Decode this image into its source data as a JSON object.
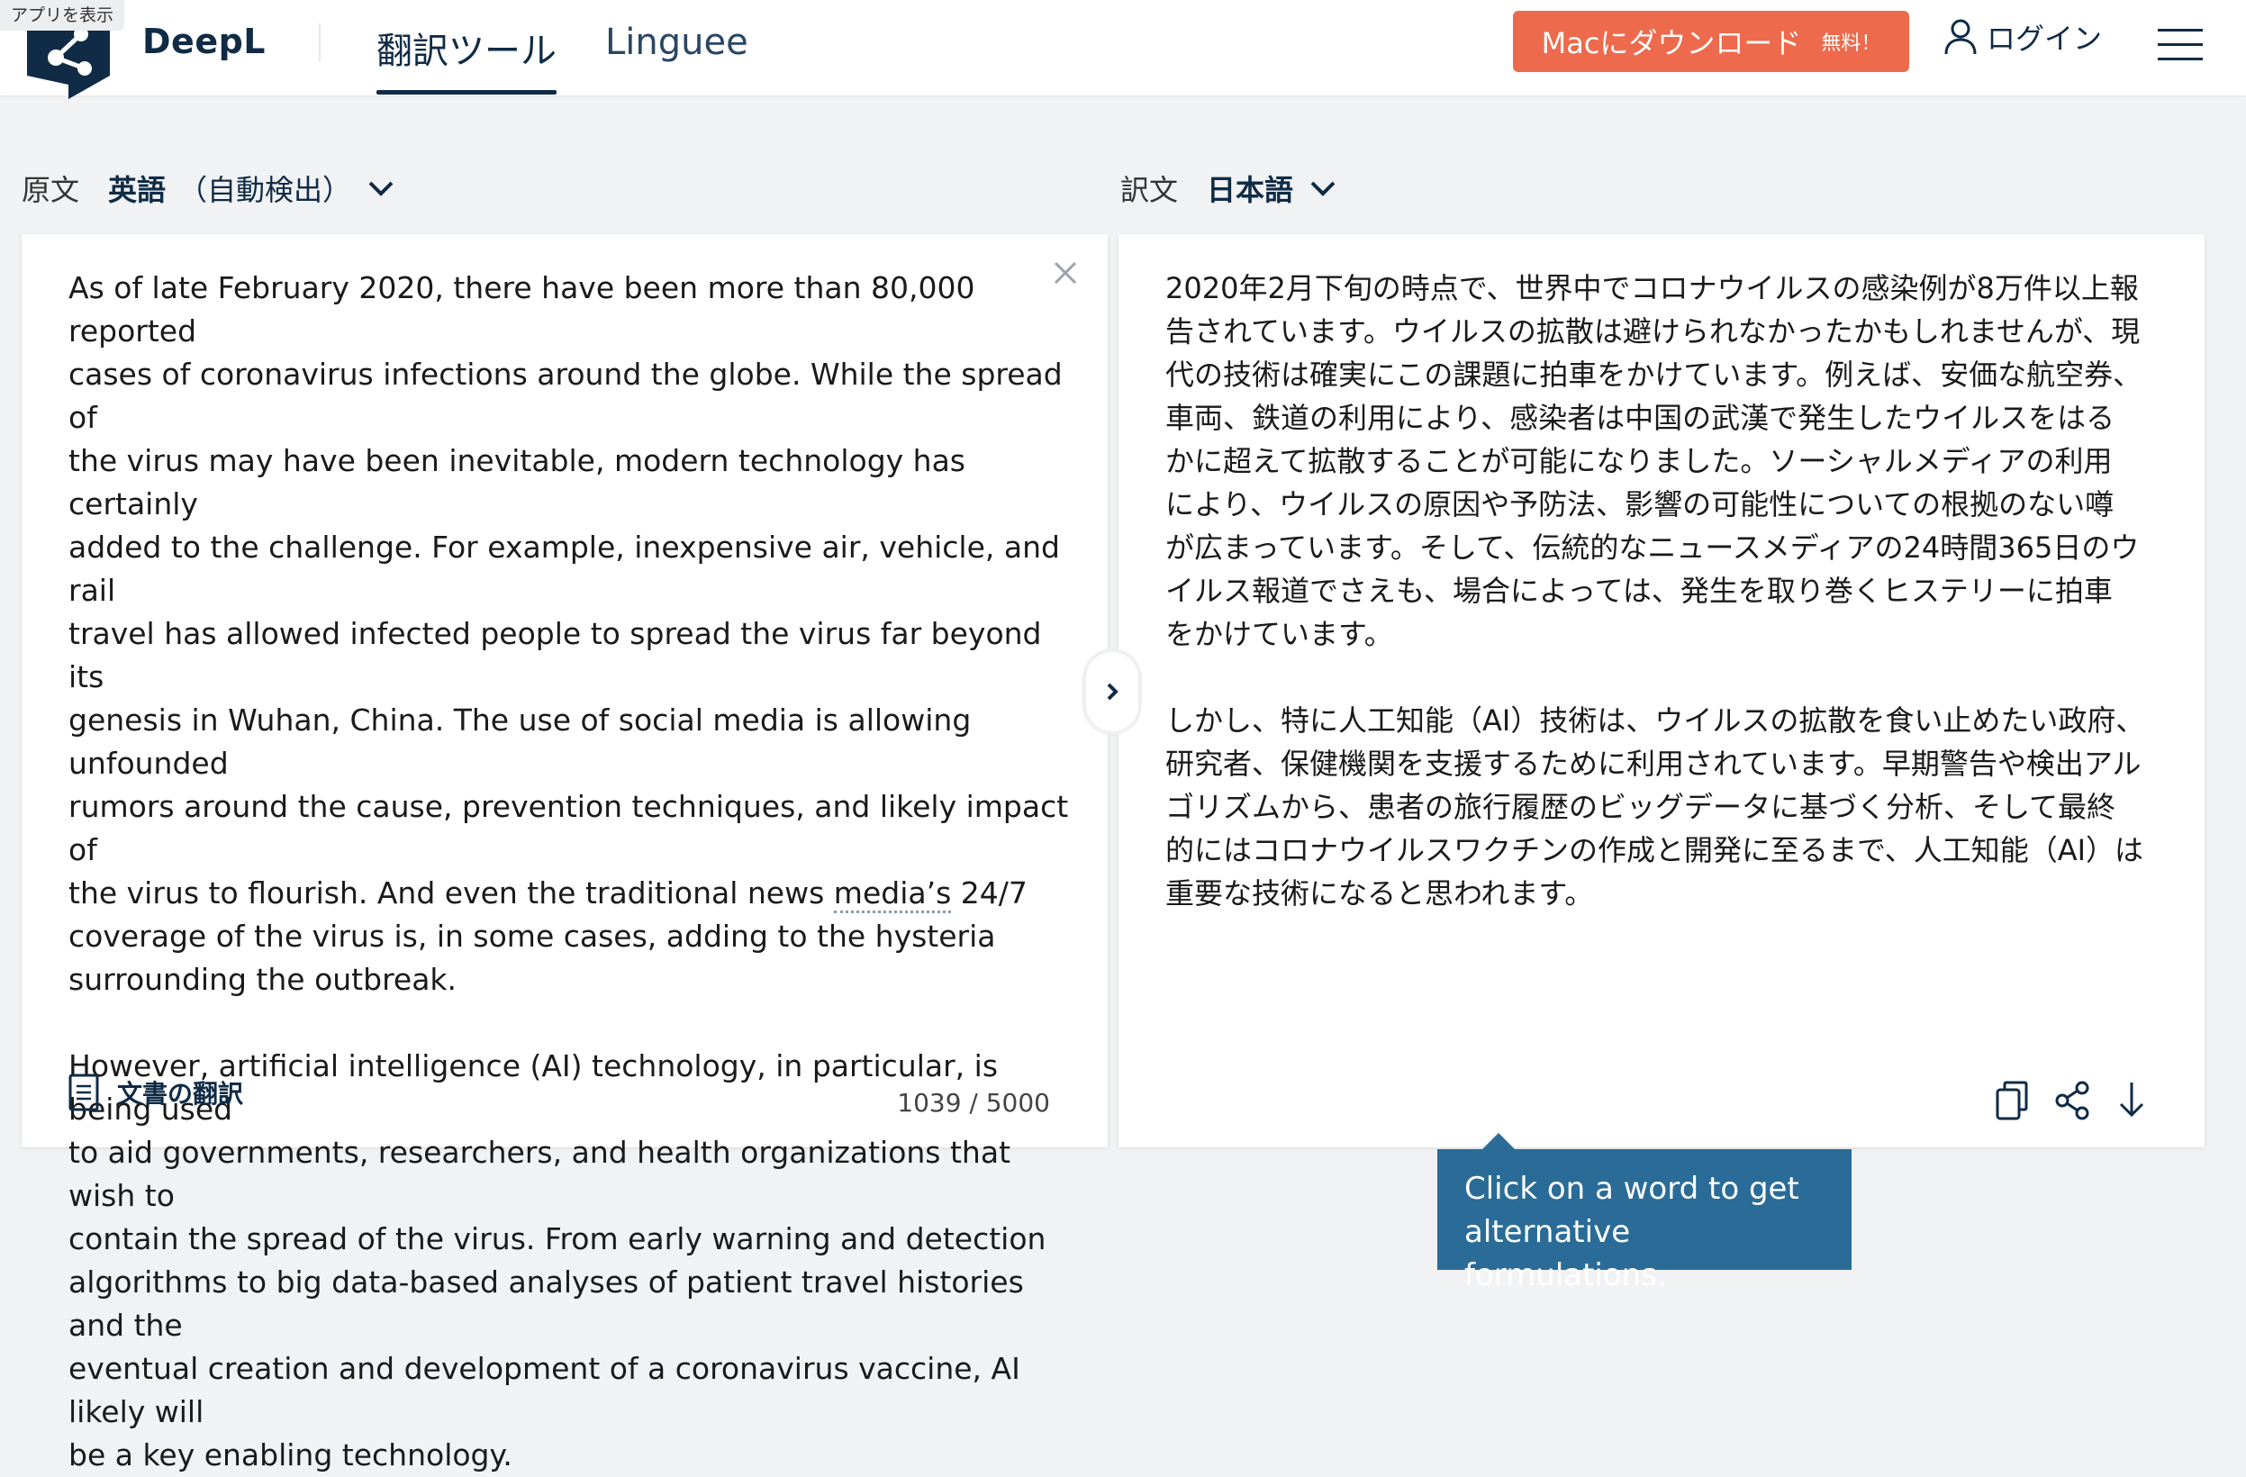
{
  "app_badge": "アプリを表示",
  "brand": "DeepL",
  "nav": {
    "translator_tab": "翻訳ツール",
    "linguee_tab": "Linguee"
  },
  "download": {
    "label": "Macにダウンロード",
    "free": "無料！"
  },
  "login_label": "ログイン",
  "source": {
    "label": "原文",
    "language": "英語",
    "auto": "（自動検出）",
    "text_before": "As of late February 2020, there have been more than 80,000 reported\ncases of coronavirus infections around the globe. While the spread of\nthe virus may have been inevitable, modern technology has certainly\nadded to the challenge. For example, inexpensive air, vehicle, and rail\ntravel has allowed infected people to spread the virus far beyond its\ngenesis in Wuhan, China. The use of social media is allowing unfounded\nrumors around the cause, prevention techniques, and likely impact of\nthe virus to flourish. And even the traditional news ",
    "text_underlined": "media’s",
    "text_after": " 24/7\ncoverage of the virus is, in some cases, adding to the hysteria\nsurrounding the outbreak.\n\nHowever, artificial intelligence (AI) technology, in particular, is being used\nto aid governments, researchers, and health organizations that wish to\ncontain the spread of the virus. From early warning and detection\nalgorithms to big data-based analyses of patient travel histories and the\neventual creation and development of a coronavirus vaccine, AI likely will\nbe a key enabling technology.",
    "doc_translate": "文書の翻訳",
    "char_count": "1039 / 5000"
  },
  "target": {
    "label": "訳文",
    "language": "日本語",
    "text": "2020年2月下旬の時点で、世界中でコロナウイルスの感染例が8万件以上報\n告されています。ウイルスの拡散は避けられなかったかもしれませんが、現\n代の技術は確実にこの課題に拍車をかけています。例えば、安価な航空券、\n車両、鉄道の利用により、感染者は中国の武漢で発生したウイルスをはる\nかに超えて拡散することが可能になりました。ソーシャルメディアの利用\nにより、ウイルスの原因や予防法、影響の可能性についての根拠のない噂\nが広まっています。そして、伝統的なニュースメディアの24時間365日のウ\nイルス報道でさえも、場合によっては、発生を取り巻くヒステリーに拍車\nをかけています。\n\nしかし、特に人工知能（AI）技術は、ウイルスの拡散を食い止めたい政府、\n研究者、保健機関を支援するために利用されています。早期警告や検出アル\nゴリズムから、患者の旅行履歴のビッグデータに基づく分析、そして最終\n的にはコロナウイルスワクチンの作成と開発に至るまで、人工知能（AI）は\n重要な技術になると思われます。"
  },
  "tooltip": "Click on a word to get\nalternative formulations.",
  "colors": {
    "brand_navy": "#0f2b46",
    "download_orange": "#ee6a4c",
    "tooltip_blue": "#2a6c97",
    "page_bg": "#f1f2f3"
  },
  "icons": [
    "deepl-logo-icon",
    "user-icon",
    "hamburger-menu-icon",
    "chevron-down-icon",
    "close-icon",
    "document-icon",
    "chevron-right-icon",
    "copy-icon",
    "share-icon",
    "download-icon"
  ]
}
